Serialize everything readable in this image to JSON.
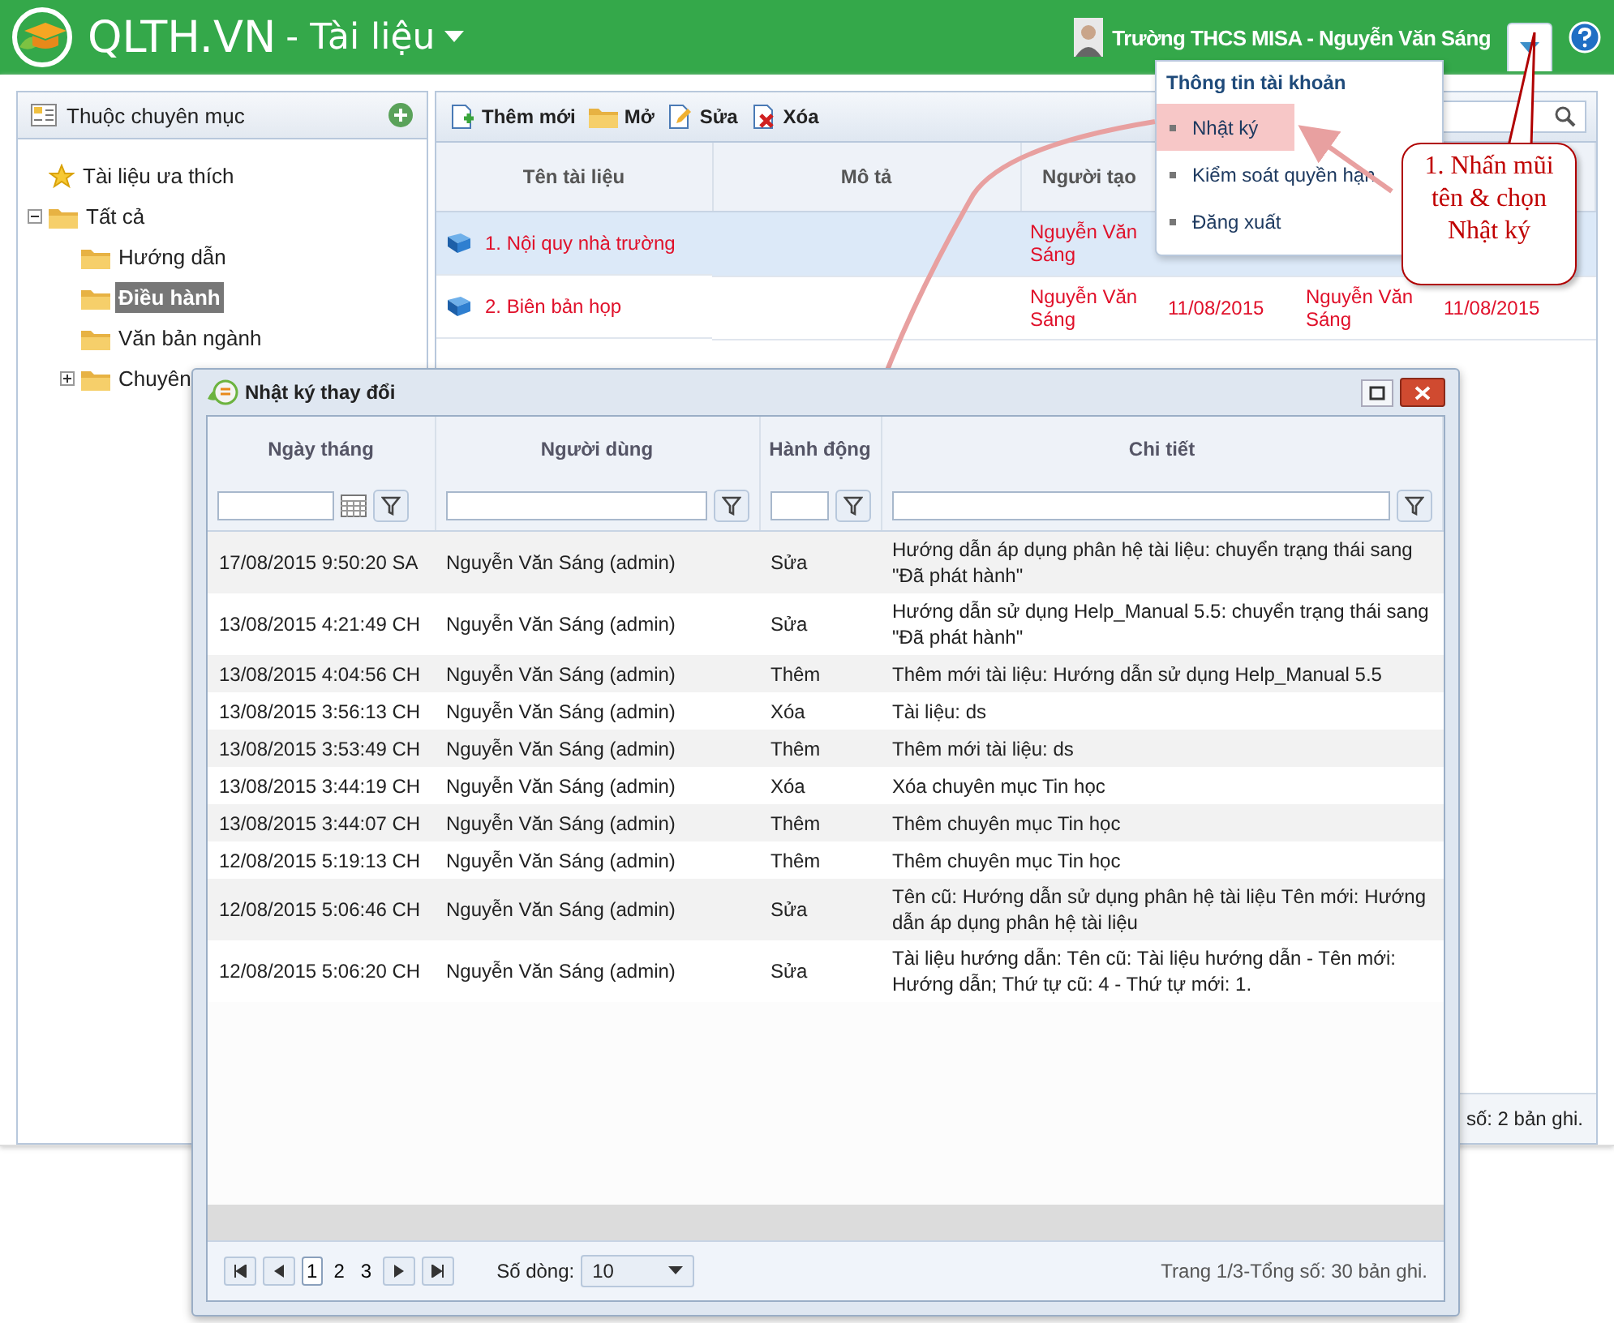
{
  "header": {
    "brand": "QLTH.VN",
    "module": "- Tài liệu",
    "user": "Trường THCS MISA - Nguyễn Văn Sáng"
  },
  "account_menu": {
    "heading": "Thông tin tài khoản",
    "items": [
      {
        "label": "Nhật ký",
        "selected": true
      },
      {
        "label": "Kiểm soát quyền hạn",
        "selected": false
      },
      {
        "label": "Đăng xuất",
        "selected": false
      }
    ]
  },
  "callout": "1. Nhấn mũi tên & chọn Nhật ký",
  "sidebar": {
    "title": "Thuộc chuyên mục",
    "tree": [
      {
        "label": "Tài liệu ưa thích",
        "selected": false
      },
      {
        "label": "Tất cả",
        "selected": false,
        "expanded": true,
        "children": [
          {
            "label": "Hướng dẫn",
            "selected": false
          },
          {
            "label": "Điều hành",
            "selected": true
          },
          {
            "label": "Văn bản ngành",
            "selected": false
          },
          {
            "label": "Chuyên",
            "selected": false,
            "expanded": false
          }
        ]
      }
    ]
  },
  "toolbar": [
    {
      "label": "Thêm mới",
      "kind": "add"
    },
    {
      "label": "Mở",
      "kind": "open"
    },
    {
      "label": "Sửa",
      "kind": "edit"
    },
    {
      "label": "Xóa",
      "kind": "delete"
    }
  ],
  "table": {
    "columns": [
      "Tên tài liệu",
      "Mô tả",
      "Người tạo"
    ],
    "rows": [
      {
        "selected": true,
        "cells": [
          "1. Nội quy nhà trường",
          "",
          "Nguyễn Văn Sáng"
        ]
      },
      {
        "selected": false,
        "cells": [
          "2. Biên bản họp",
          "",
          "Nguyễn Văn Sáng",
          "11/08/2015",
          "Nguyễn Văn Sáng",
          "11/08/2015"
        ]
      }
    ]
  },
  "status_bar": "số: 2 bản ghi.",
  "dialog": {
    "title": "Nhật ký thay đổi",
    "columns": [
      "Ngày tháng",
      "Người dùng",
      "Hành động",
      "Chi tiết"
    ],
    "rows": [
      [
        "17/08/2015 9:50:20 SA",
        "Nguyễn Văn Sáng (admin)",
        "Sửa",
        "Hướng dẫn áp dụng phân hệ tài liệu: chuyển trạng thái sang \"Đã phát hành\""
      ],
      [
        "13/08/2015 4:21:49 CH",
        "Nguyễn Văn Sáng (admin)",
        "Sửa",
        "Hướng dẫn sử dụng Help_Manual 5.5: chuyển trạng thái sang \"Đã phát hành\""
      ],
      [
        "13/08/2015 4:04:56 CH",
        "Nguyễn Văn Sáng (admin)",
        "Thêm",
        "Thêm mới tài liệu: Hướng dẫn sử dụng Help_Manual 5.5"
      ],
      [
        "13/08/2015 3:56:13 CH",
        "Nguyễn Văn Sáng (admin)",
        "Xóa",
        "Tài liệu: ds"
      ],
      [
        "13/08/2015 3:53:49 CH",
        "Nguyễn Văn Sáng (admin)",
        "Thêm",
        "Thêm mới tài liệu: ds"
      ],
      [
        "13/08/2015 3:44:19 CH",
        "Nguyễn Văn Sáng (admin)",
        "Xóa",
        "Xóa chuyên mục Tin học"
      ],
      [
        "13/08/2015 3:44:07 CH",
        "Nguyễn Văn Sáng (admin)",
        "Thêm",
        "Thêm chuyên mục Tin học"
      ],
      [
        "12/08/2015 5:19:13 CH",
        "Nguyễn Văn Sáng (admin)",
        "Thêm",
        "Thêm chuyên mục Tin học"
      ],
      [
        "12/08/2015 5:06:46 CH",
        "Nguyễn Văn Sáng (admin)",
        "Sửa",
        "Tên cũ: Hướng dẫn sử dụng phân hệ tài liệu Tên mới: Hướng dẫn áp dụng phân hệ tài liệu"
      ],
      [
        "12/08/2015 5:06:20 CH",
        "Nguyễn Văn Sáng (admin)",
        "Sửa",
        "Tài liệu hướng dẫn: Tên cũ: Tài liệu hướng dẫn - Tên mới: Hướng dẫn; Thứ tự cũ: 4 - Thứ tự mới: 1."
      ]
    ],
    "pager": {
      "pages": [
        {
          "label": "1",
          "selected": true
        },
        {
          "label": "2",
          "selected": false
        },
        {
          "label": "3",
          "selected": false
        }
      ],
      "rows_label": "Số dòng:",
      "rows_value": "10",
      "summary": "Trang 1/3-Tổng số: 30 bản ghi."
    }
  }
}
